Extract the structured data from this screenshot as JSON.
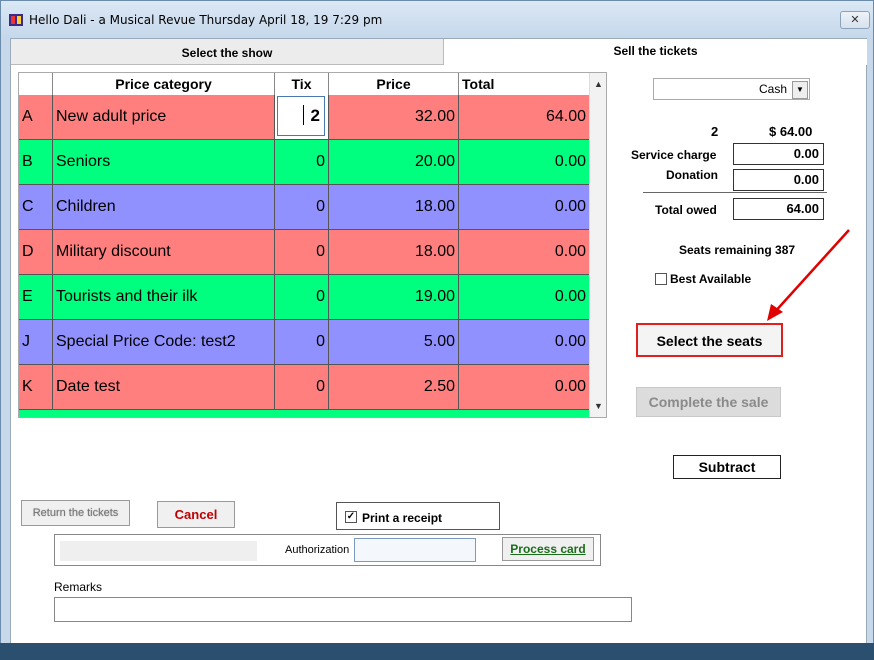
{
  "window": {
    "title": "Hello Dali - a Musical Revue Thursday April 18, 19 7:29 pm",
    "close_glyph": "✕"
  },
  "tabs": {
    "select_show": "Select the show",
    "sell_tickets": "Sell the tickets"
  },
  "grid": {
    "headers": {
      "price_category": "Price category",
      "tix": "Tix",
      "price": "Price",
      "total": "Total"
    },
    "rows": [
      {
        "code": "A",
        "category": "New adult price",
        "tix": "2",
        "price": "32.00",
        "total": "64.00",
        "color": "#ff7f7f"
      },
      {
        "code": "B",
        "category": "Seniors",
        "tix": "0",
        "price": "20.00",
        "total": "0.00",
        "color": "#00ff7f"
      },
      {
        "code": "C",
        "category": "Children",
        "tix": "0",
        "price": "18.00",
        "total": "0.00",
        "color": "#9090ff"
      },
      {
        "code": "D",
        "category": "Military discount",
        "tix": "0",
        "price": "18.00",
        "total": "0.00",
        "color": "#ff7f7f"
      },
      {
        "code": "E",
        "category": "Tourists and their ilk",
        "tix": "0",
        "price": "19.00",
        "total": "0.00",
        "color": "#00ff7f"
      },
      {
        "code": "J",
        "category": "Special Price Code: test2",
        "tix": "0",
        "price": "5.00",
        "total": "0.00",
        "color": "#9090ff"
      },
      {
        "code": "K",
        "category": "Date test",
        "tix": "0",
        "price": "2.50",
        "total": "0.00",
        "color": "#ff7f7f"
      }
    ],
    "partial_row_color": "#00ff7f"
  },
  "payment": {
    "method": "Cash",
    "tix_count": "2",
    "total_display": "$ 64.00",
    "service_charge_label": "Service charge",
    "service_charge": "0.00",
    "donation_label": "Donation",
    "donation": "0.00",
    "total_owed_label": "Total owed",
    "total_owed": "64.00"
  },
  "seats": {
    "remaining": "Seats remaining 387",
    "best_available": "Best Available",
    "select_seats": "Select the seats",
    "complete_sale": "Complete the sale",
    "subtract": "Subtract"
  },
  "bottom": {
    "return_tickets": "Return the tickets",
    "cancel": "Cancel",
    "print_receipt": "Print a receipt",
    "authorization": "Authorization",
    "process_card": "Process card",
    "remarks": "Remarks"
  },
  "colors": {
    "annotation_arrow": "#e00000",
    "process_card_text": "#1a6e1a"
  }
}
